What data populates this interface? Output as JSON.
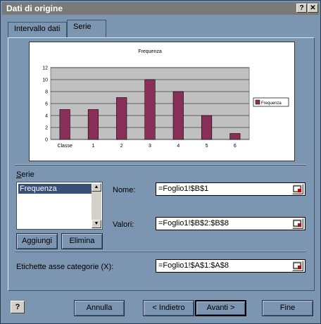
{
  "window": {
    "title": "Dati di origine",
    "help_glyph": "?",
    "close_glyph": "✕"
  },
  "tabs": [
    {
      "label": "Intervallo dati"
    },
    {
      "label": "Serie"
    }
  ],
  "chart_data": {
    "type": "bar",
    "title": "Frequenza",
    "categories": [
      "Classe",
      "1",
      "2",
      "3",
      "4",
      "5",
      "6"
    ],
    "series": [
      {
        "name": "Frequenza",
        "values": [
          5,
          5,
          7,
          10,
          8,
          4,
          1
        ],
        "color": "#8a2f57"
      }
    ],
    "ylim": [
      0,
      12
    ],
    "yticks": [
      0,
      2,
      4,
      6,
      8,
      10,
      12
    ],
    "grid": true,
    "legend": "right"
  },
  "series_section": {
    "label": "Serie",
    "items": [
      "Frequenza"
    ],
    "add_label": "Aggiungi",
    "remove_label": "Elimina"
  },
  "fields": {
    "name_label": "Nome:",
    "name_value": "=Foglio1!$B$1",
    "values_label": "Valori:",
    "values_value": "=Foglio1!$B$2:$B$8",
    "categories_label": "Etichette asse categorie (X):",
    "categories_value": "=Foglio1!$A$1:$A$8"
  },
  "footer": {
    "help": "?",
    "cancel": "Annulla",
    "back": "< Indietro",
    "next": "Avanti >",
    "finish": "Fine"
  }
}
